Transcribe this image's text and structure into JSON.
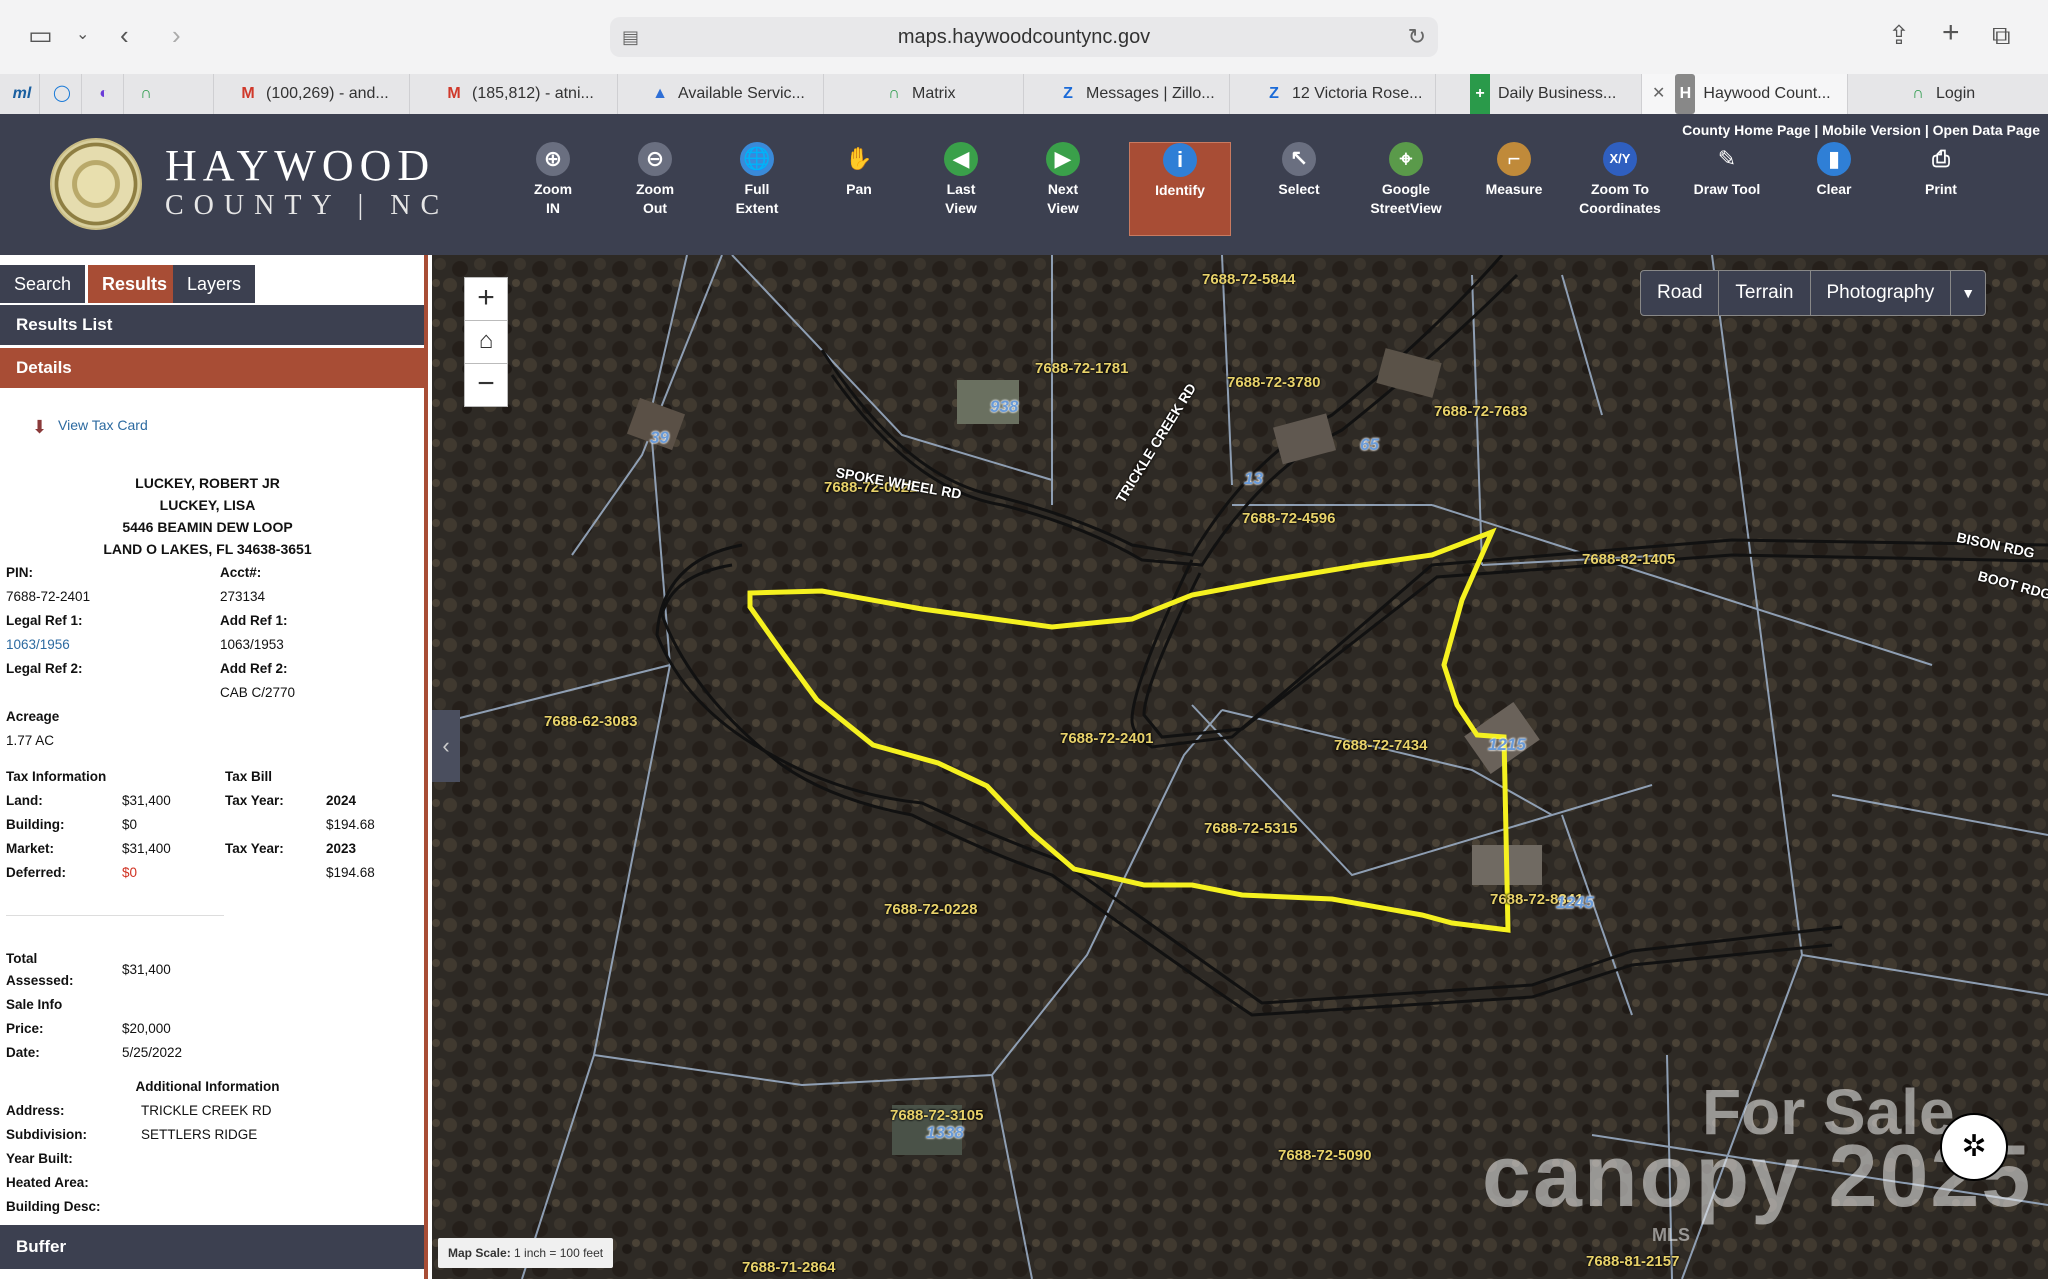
{
  "browser": {
    "url": "maps.haywoodcountync.gov",
    "tabs": [
      {
        "fav": "ml",
        "label": ""
      },
      {
        "fav": "◯",
        "label": ""
      },
      {
        "fav": "◐",
        "label": ""
      },
      {
        "fav": "∩",
        "label": ""
      },
      {
        "fav": "M",
        "label": "(100,269) - and..."
      },
      {
        "fav": "M",
        "label": "(185,812) - atni..."
      },
      {
        "fav": "▲",
        "label": "Available Servic..."
      },
      {
        "fav": "∩",
        "label": "Matrix"
      },
      {
        "fav": "Z",
        "label": "Messages | Zillo..."
      },
      {
        "fav": "Z",
        "label": "12 Victoria Rose..."
      },
      {
        "fav": "+",
        "label": "Daily Business..."
      },
      {
        "fav": "H",
        "label": "Haywood Count..."
      },
      {
        "fav": "∩",
        "label": "Login"
      }
    ]
  },
  "header": {
    "logo_title": "HAYWOOD",
    "logo_sub": "COUNTY | NC",
    "links": "County Home Page | Mobile Version | Open Data Page",
    "tools": [
      {
        "l1": "Zoom",
        "l2": "IN",
        "icon": "⊕",
        "color": "#6a6f80"
      },
      {
        "l1": "Zoom",
        "l2": "Out",
        "icon": "⊖",
        "color": "#6a6f80"
      },
      {
        "l1": "Full",
        "l2": "Extent",
        "icon": "🌐",
        "color": "#3a8ad8"
      },
      {
        "l1": "Pan",
        "l2": "",
        "icon": "✋",
        "color": "transparent"
      },
      {
        "l1": "Last",
        "l2": "View",
        "icon": "◀",
        "color": "#3aa04a"
      },
      {
        "l1": "Next",
        "l2": "View",
        "icon": "▶",
        "color": "#3aa04a"
      },
      {
        "l1": "Identify",
        "l2": "",
        "icon": "i",
        "color": "#2f7fd6"
      },
      {
        "l1": "Select",
        "l2": "",
        "icon": "↖",
        "color": "#6a6f80"
      },
      {
        "l1": "Google",
        "l2": "StreetView",
        "icon": "⌖",
        "color": "#5a9a4a"
      },
      {
        "l1": "Measure",
        "l2": "",
        "icon": "⌐",
        "color": "#c08a3a"
      },
      {
        "l1": "Zoom To",
        "l2": "Coordinates",
        "icon": "X/Y",
        "color": "#2f5fc0"
      },
      {
        "l1": "Draw Tool",
        "l2": "",
        "icon": "✎",
        "color": "transparent"
      },
      {
        "l1": "Clear",
        "l2": "",
        "icon": "▮",
        "color": "#2f7fd6"
      },
      {
        "l1": "Print",
        "l2": "",
        "icon": "⎙",
        "color": "transparent"
      }
    ]
  },
  "panel": {
    "tabs": [
      "Search",
      "Results",
      "Layers"
    ],
    "results_list": "Results List",
    "details": "Details",
    "view_tax_card": "View Tax Card",
    "owner_lines": [
      "LUCKEY, ROBERT JR",
      "LUCKEY, LISA",
      "5446 BEAMIN DEW LOOP",
      "LAND O LAKES, FL 34638-3651"
    ],
    "pin_label": "PIN:",
    "pin": "7688-72-2401",
    "acct_label": "Acct#:",
    "acct": "273134",
    "legal_ref1_label": "Legal Ref 1:",
    "legal_ref1": "1063/1956",
    "add_ref1_label": "Add Ref 1:",
    "add_ref1": "1063/1953",
    "legal_ref2_label": "Legal Ref 2:",
    "add_ref2_label": "Add Ref 2:",
    "add_ref2": "CAB C/2770",
    "acreage_label": "Acreage",
    "acreage": "1.77 AC",
    "tax_info_label": "Tax Information",
    "tax_bill_label": "Tax Bill",
    "land_label": "Land:",
    "land": "$31,400",
    "tax_year_label": "Tax Year:",
    "tax_year1": "2024",
    "building_label": "Building:",
    "building": "$0",
    "bill1": "$194.68",
    "market_label": "Market:",
    "market": "$31,400",
    "tax_year2": "2023",
    "deferred_label": "Deferred:",
    "deferred": "$0",
    "bill2": "$194.68",
    "total_label1": "Total",
    "total_label2": "Assessed:",
    "total": "$31,400",
    "sale_info_label": "Sale Info",
    "price_label": "Price:",
    "price": "$20,000",
    "date_label": "Date:",
    "date": "5/25/2022",
    "additional_label": "Additional Information",
    "address_label": "Address:",
    "address": "TRICKLE CREEK RD",
    "subdivision_label": "Subdivision:",
    "subdivision": "SETTLERS RIDGE",
    "year_built_label": "Year Built:",
    "heated_area_label": "Heated Area:",
    "building_desc_label": "Building Desc:",
    "buffer": "Buffer"
  },
  "map": {
    "basemaps": [
      "Road",
      "Terrain",
      "Photography"
    ],
    "scale_label": "Map Scale:",
    "scale_value": "1 inch = 100 feet",
    "parcels": [
      "7688-72-5844",
      "7688-72-1781",
      "7688-72-3780",
      "7688-72-7683",
      "7688-72-0621",
      "7688-72-4596",
      "7688-82-1405",
      "7688-62-3083",
      "7688-72-2401",
      "7688-72-7434",
      "7688-72-5315",
      "7688-72-0228",
      "7688-72-8341",
      "7688-72-3105",
      "7688-72-5090",
      "7688-71-2864",
      "7688-81-2157"
    ],
    "addresses": [
      "39",
      "938",
      "65",
      "13",
      "1215",
      "1245",
      "1338"
    ],
    "roads": [
      "SPOKE WHEEL RD",
      "TRICKLE CREEK RD",
      "BISON RDG",
      "BOOT RDG"
    ],
    "watermark": [
      "For Sale",
      "canopy 2025",
      "MLS"
    ]
  }
}
